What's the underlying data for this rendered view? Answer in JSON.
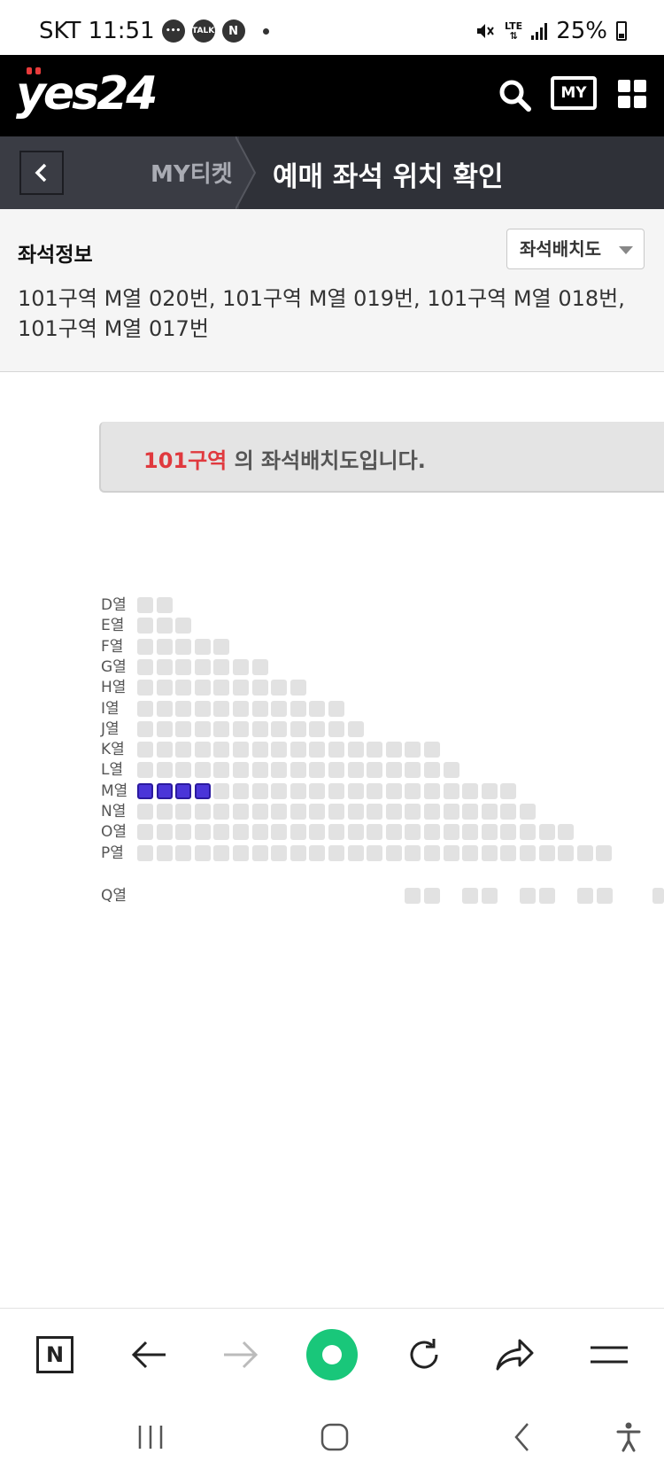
{
  "status_bar": {
    "carrier_time": "SKT 11:51",
    "badges": [
      "",
      "TALK",
      "N"
    ],
    "network": "LTE",
    "battery": "25%"
  },
  "app_bar": {
    "logo": "yes24",
    "my_label": "MY"
  },
  "sub_bar": {
    "crumb": "MY티켓",
    "title": "예매 좌석 위치 확인"
  },
  "seat_info": {
    "label": "좌석정보",
    "select_label": "좌석배치도",
    "value": "101구역 M열 020번, 101구역 M열 019번, 101구역 M열 018번, 101구역 M열 017번"
  },
  "map": {
    "zone": "101구역",
    "suffix": " 의 좌석배치도입니다.",
    "rows": [
      {
        "label": "D열",
        "count": 2
      },
      {
        "label": "E열",
        "count": 3
      },
      {
        "label": "F열",
        "count": 5
      },
      {
        "label": "G열",
        "count": 7
      },
      {
        "label": "H열",
        "count": 9
      },
      {
        "label": "I열",
        "count": 11
      },
      {
        "label": "J열",
        "count": 12
      },
      {
        "label": "K열",
        "count": 16
      },
      {
        "label": "L열",
        "count": 17
      },
      {
        "label": "M열",
        "count": 20,
        "selected": [
          0,
          1,
          2,
          3
        ]
      },
      {
        "label": "N열",
        "count": 21
      },
      {
        "label": "O열",
        "count": 23
      },
      {
        "label": "P열",
        "count": 25
      }
    ],
    "q_row": {
      "label": "Q열"
    },
    "selected_color": "#4a35d8",
    "seat_color": "#e2e2e2"
  },
  "toolbar": {
    "items": [
      "n-icon",
      "back-arrow-icon",
      "forward-arrow-icon",
      "green-dot-icon",
      "reload-icon",
      "share-icon",
      "menu-icon"
    ]
  }
}
